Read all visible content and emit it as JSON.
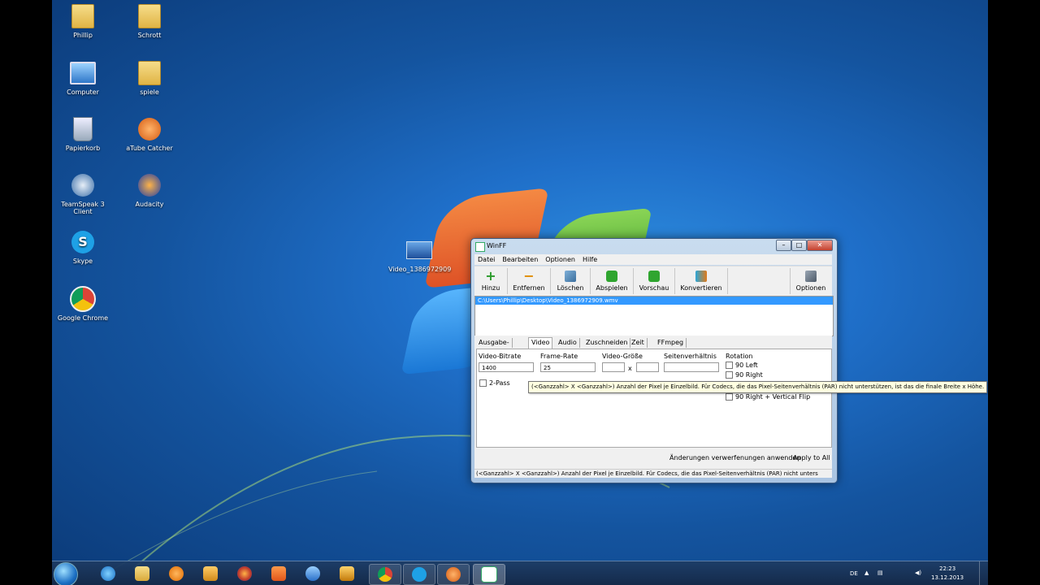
{
  "desktop": {
    "icons": [
      {
        "label": "Phillip"
      },
      {
        "label": "Schrott"
      },
      {
        "label": "Computer"
      },
      {
        "label": "spiele"
      },
      {
        "label": "Papierkorb"
      },
      {
        "label": "aTube Catcher"
      },
      {
        "label": "TeamSpeak 3 Client"
      },
      {
        "label": "Audacity"
      },
      {
        "label": "Skype"
      },
      {
        "label": "Google Chrome"
      },
      {
        "label": "Video_1386972909"
      }
    ]
  },
  "window": {
    "title": "WinFF",
    "menu": [
      "Datei",
      "Bearbeiten",
      "Optionen",
      "Hilfe"
    ],
    "toolbar": {
      "add": "Hinzu",
      "remove": "Entfernen",
      "clear": "Löschen",
      "play": "Abspielen",
      "preview": "Vorschau",
      "convert": "Konvertieren",
      "options": "Optionen"
    },
    "file_path": "C:\\Users\\Phillip\\Desktop\\Video_1386972909.wmv",
    "tabs": [
      "Ausgabe-Details",
      "Video",
      "Audio",
      "Zuschneiden",
      "Zeit",
      "FFmpeg"
    ],
    "video": {
      "bitrate_label": "Video-Bitrate",
      "bitrate_value": "1400",
      "framerate_label": "Frame-Rate",
      "framerate_value": "25",
      "size_label": "Video-Größe",
      "size_separator": "x",
      "aspect_label": "Seitenverhältnis",
      "rotation_label": "Rotation",
      "rot_left": "90 Left",
      "rot_right": "90 Right",
      "rot_right_flip": "90 Right + Vertical Flip",
      "twopass": "2-Pass"
    },
    "tooltip": "(<Ganzzahl> X <Ganzzahl>) Anzahl der Pixel je Einzelbild. Für Codecs, die das Pixel-Seitenverhältnis (PAR) nicht unterstützen, ist das die finale Breite x Höhe.",
    "discard_label": "Änderungen verwerfenungen anwenden",
    "apply_all_label": "Apply to All",
    "status": "(<Ganzzahl> X <Ganzzahl>) Anzahl der Pixel je Einzelbild. Für Codecs, die das Pixel-Seitenverhältnis (PAR) nicht unters"
  },
  "taskbar": {
    "language": "DE",
    "time": "22:23",
    "date": "13.12.2013"
  },
  "colors": {
    "selection": "#3399ff",
    "desktop_blue": "#1f6fc9",
    "tooltip_bg": "#ffffe1"
  }
}
